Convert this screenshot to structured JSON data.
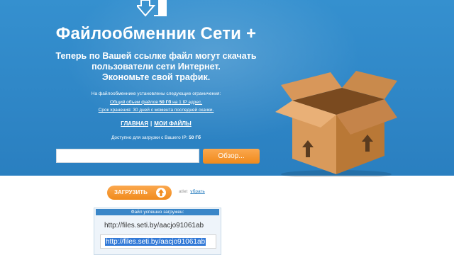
{
  "header": {
    "title": "Файлообменник Сети +",
    "tagline": [
      "Теперь по Вашей ссылке файл могут скачать",
      "пользователи сети Интернет.",
      "Экономьте свой трафик."
    ]
  },
  "limits": {
    "intro": "На файлообменнике установлены следующие ограничения:",
    "volume_prefix": "Общий объем файлов ",
    "volume_value": "50 Гб",
    "volume_suffix": " на 1 IP адрес.",
    "retention": "Срок хранения: 30 дней с момента последней скачки."
  },
  "nav": {
    "home": "ГЛАВНАЯ",
    "separator": "|",
    "my_files": "МОИ ФАЙЛЫ"
  },
  "ip_info": {
    "prefix": "Доступно для загрузки с Вашего IP: ",
    "value": "50 Гб"
  },
  "upload_form": {
    "file_value": "",
    "browse_label": "Обзор...",
    "upload_label": "ЗАГРУЗИТЬ",
    "filename_placeholder": "atlet",
    "remove_label": "убрать"
  },
  "result": {
    "header": "Файл успешно загружен:",
    "link_plain": "http://files.seti.by/aacjo91061ab",
    "link_selected": "http://files.seti.by/aacjo91061ab"
  },
  "colors": {
    "header_bg": "#2f87c8",
    "accent_orange": "#f39a2e",
    "selection_blue": "#3279d7"
  }
}
